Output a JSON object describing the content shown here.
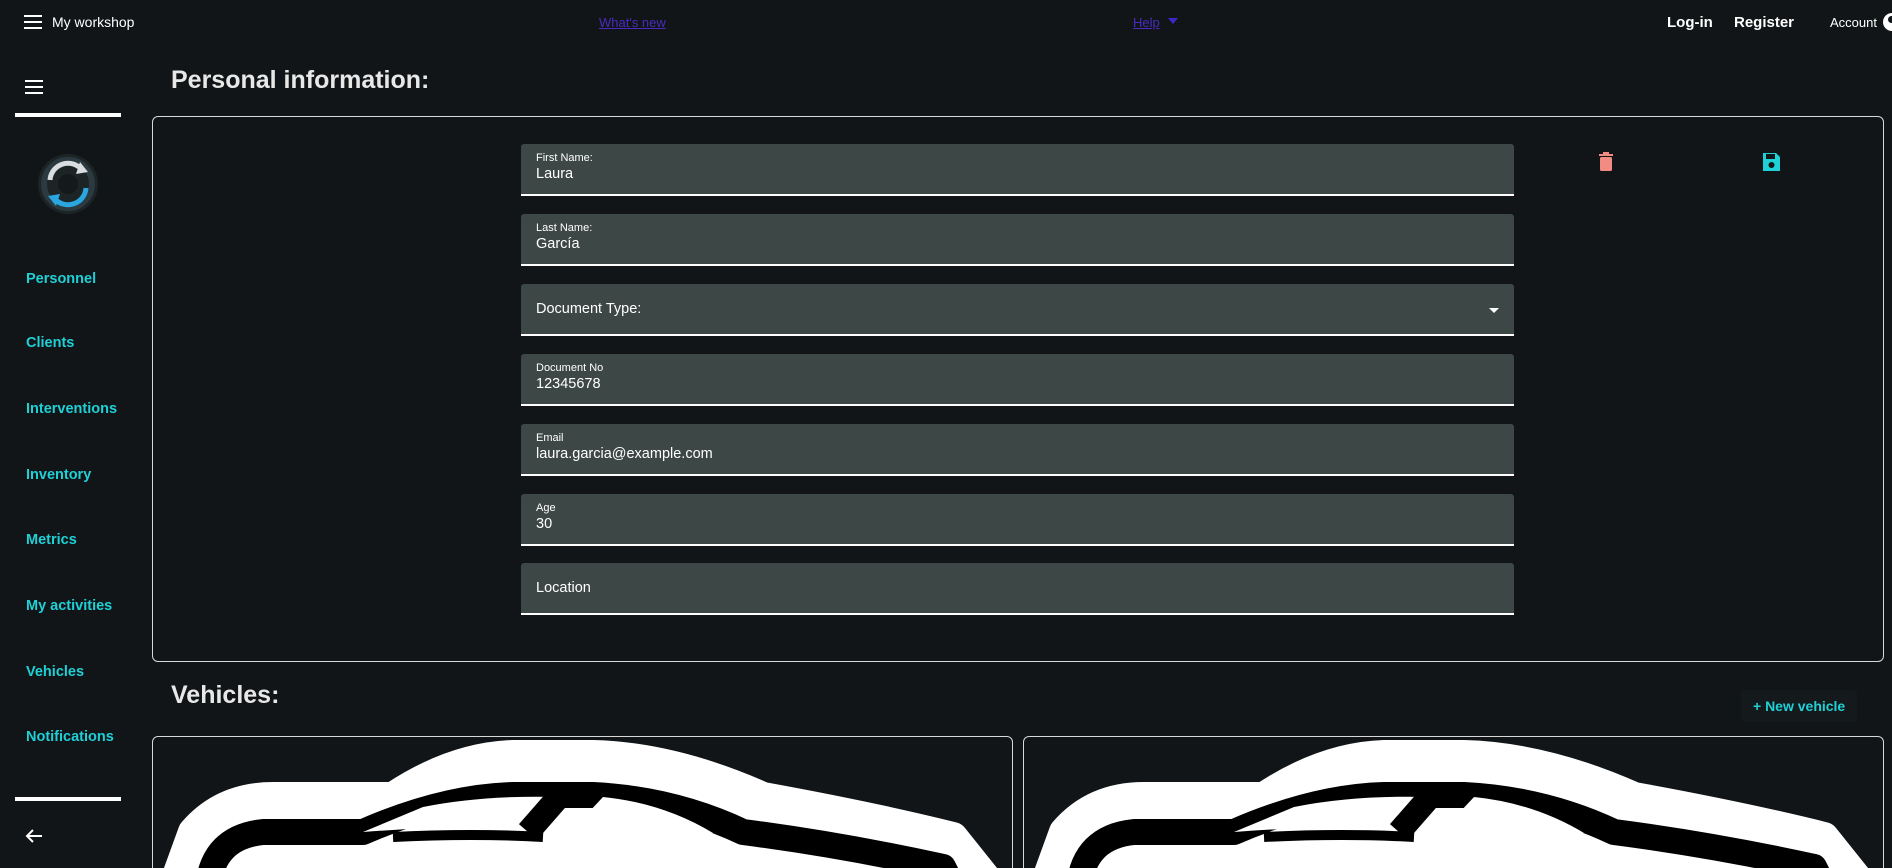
{
  "topbar": {
    "app_title": "My workshop",
    "whats_new": "What's new",
    "help": "Help",
    "login": "Log-in",
    "register": "Register",
    "account": "Account"
  },
  "sidebar": {
    "items": [
      {
        "label": "Personnel"
      },
      {
        "label": "Clients"
      },
      {
        "label": "Interventions"
      },
      {
        "label": "Inventory"
      },
      {
        "label": "Metrics"
      },
      {
        "label": "My activities"
      },
      {
        "label": "Vehicles"
      },
      {
        "label": "Notifications"
      }
    ]
  },
  "personal": {
    "title": "Personal information:",
    "fields": {
      "first_name": {
        "label": "First Name:",
        "value": "Laura"
      },
      "last_name": {
        "label": "Last Name:",
        "value": "García"
      },
      "document_type": {
        "label": "Document Type:"
      },
      "document_no": {
        "label": "Document No",
        "value": "12345678"
      },
      "email": {
        "label": "Email",
        "value": "laura.garcia@example.com"
      },
      "age": {
        "label": "Age",
        "value": "30"
      },
      "location": {
        "label": "Location"
      }
    }
  },
  "vehicles": {
    "title": "Vehicles:",
    "new_button": "+ New vehicle"
  },
  "colors": {
    "background": "#111517",
    "accent": "#1fd0d6",
    "field_bg": "#3d4746",
    "delete": "#f28b82",
    "link": "#4b2bbf"
  },
  "icons": {
    "menu": "hamburger-icon",
    "help_caret": "chevron-down-icon",
    "account": "account-circle-icon",
    "delete": "trash-icon",
    "save": "floppy-disk-icon",
    "back": "arrow-left-icon",
    "vehicle": "car-icon"
  }
}
